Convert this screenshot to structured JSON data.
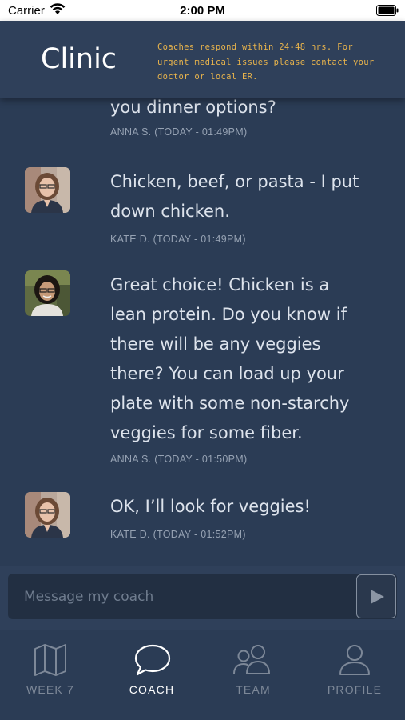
{
  "status_bar": {
    "carrier": "Carrier",
    "time": "2:00 PM"
  },
  "header": {
    "title": "Clinic",
    "notice_line1": "Coaches respond within 24-48 hrs. For",
    "notice_line2": "urgent medical issues please contact your",
    "notice_line3": "doctor or local ER."
  },
  "messages": [
    {
      "lines": [
        "you dinner options?"
      ],
      "meta": "ANNA S. (TODAY - 01:49PM)",
      "avatar": null
    },
    {
      "lines": [
        "Chicken, beef, or pasta - I put",
        "down chicken."
      ],
      "meta": "KATE D. (TODAY - 01:49PM)",
      "avatar": "kate-avatar"
    },
    {
      "lines": [
        "Great choice! Chicken is a",
        "lean protein. Do you know if",
        "there will be any veggies",
        "there? You can load up your",
        "plate with some non-starchy",
        "veggies for some fiber."
      ],
      "meta": "ANNA S. (TODAY - 01:50PM)",
      "avatar": "anna-avatar"
    },
    {
      "lines": [
        "OK, I’ll look for veggies!"
      ],
      "meta": "KATE D. (TODAY - 01:52PM)",
      "avatar": "kate-avatar"
    }
  ],
  "composer": {
    "placeholder": "Message my coach",
    "value": ""
  },
  "tabs": [
    {
      "label": "WEEK 7",
      "icon": "map-icon",
      "active": false
    },
    {
      "label": "COACH",
      "icon": "chat-bubble-icon",
      "active": true
    },
    {
      "label": "TEAM",
      "icon": "team-icon",
      "active": false
    },
    {
      "label": "PROFILE",
      "icon": "profile-icon",
      "active": false
    }
  ],
  "colors": {
    "background": "#2b3c55",
    "header": "#2f405a",
    "notice": "#e9b44c",
    "active_tab": "#ffffff",
    "inactive_tab": "#7d8898"
  }
}
